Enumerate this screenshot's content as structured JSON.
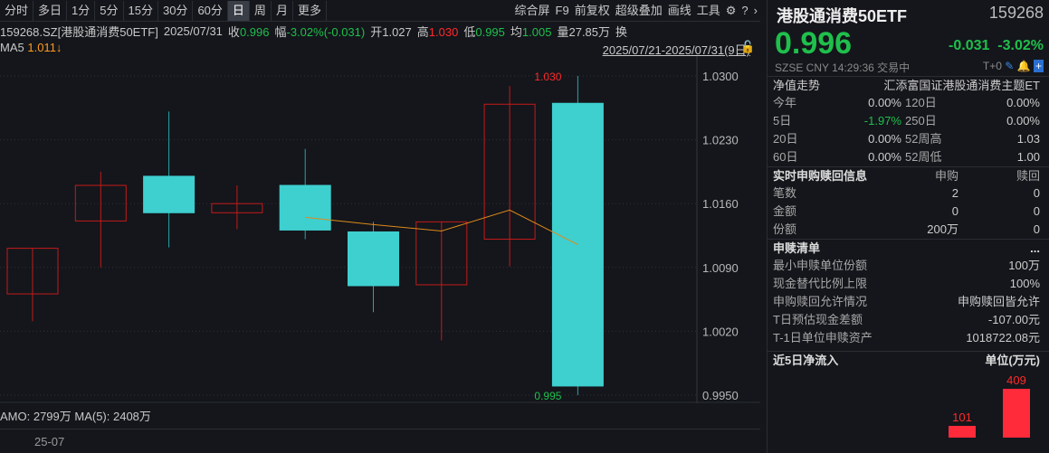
{
  "toolbar": {
    "periods": [
      "分时",
      "多日",
      "1分",
      "5分",
      "15分",
      "30分",
      "60分",
      "日",
      "周",
      "月",
      "更多"
    ],
    "active": "日",
    "right": [
      "综合屏",
      "F9",
      "前复权",
      "超级叠加",
      "画线",
      "工具"
    ]
  },
  "info": {
    "code": "159268.SZ[港股通消费50ETF]",
    "date": "2025/07/31",
    "close_label": "收",
    "close": "0.996",
    "chg_label": "幅",
    "chg": "-3.02%(-0.031)",
    "open_label": "开",
    "open": "1.027",
    "high_label": "高",
    "high": "1.030",
    "low_label": "低",
    "low": "0.995",
    "avg_label": "均",
    "avg": "1.005",
    "vol_label": "量",
    "vol": "27.85万",
    "turn_label": "换"
  },
  "ma": {
    "label": "MA5",
    "value": "1.011↓"
  },
  "range": "2025/07/21-2025/07/31(9日)",
  "chart_data": {
    "type": "candlestick",
    "ylim": [
      0.995,
      1.03
    ],
    "yticks": [
      "1.0300",
      "1.0230",
      "1.0160",
      "1.0090",
      "1.0020",
      "0.9950"
    ],
    "candles": [
      {
        "o": 1.0061,
        "h": 1.0111,
        "l": 1.0031,
        "c": 1.0111
      },
      {
        "o": 1.0141,
        "h": 1.0195,
        "l": 1.009,
        "c": 1.018
      },
      {
        "o": 1.019,
        "h": 1.0261,
        "l": 1.0112,
        "c": 1.015
      },
      {
        "o": 1.015,
        "h": 1.018,
        "l": 1.0132,
        "c": 1.016
      },
      {
        "o": 1.018,
        "h": 1.022,
        "l": 1.0121,
        "c": 1.0131
      },
      {
        "o": 1.0129,
        "h": 1.014,
        "l": 1.0041,
        "c": 1.007
      },
      {
        "o": 1.0071,
        "h": 1.014,
        "l": 1.001,
        "c": 1.014
      },
      {
        "o": 1.0121,
        "h": 1.0289,
        "l": 1.0091,
        "c": 1.0269
      },
      {
        "o": 1.027,
        "h": 1.03,
        "l": 0.995,
        "c": 0.996
      }
    ],
    "ma5": [
      null,
      null,
      null,
      null,
      1.0145,
      1.0137,
      1.013,
      1.0153,
      1.0115
    ],
    "high_mark": "1.030",
    "low_mark": "0.995",
    "xlabel": "25-07"
  },
  "amo": "AMO: 2799万 MA(5): 2408万",
  "side": {
    "name": "港股通消费50ETF",
    "code": "159268",
    "price": "0.996",
    "chg": "-0.031",
    "pct": "-3.02%",
    "meta": "SZSE  CNY  14:29:36  交易中",
    "t0": "T+0",
    "nav_title": "净值走势",
    "fund": "汇添富国证港股通消费主题ET",
    "perf": [
      [
        "今年",
        "0.00%",
        "120日",
        "0.00%"
      ],
      [
        "5日",
        "-1.97%",
        "250日",
        "0.00%"
      ],
      [
        "20日",
        "0.00%",
        "52周高",
        "1.03"
      ],
      [
        "60日",
        "0.00%",
        "52周低",
        "1.00"
      ]
    ],
    "sub_title": "实时申购赎回信息",
    "sub_h1": "申购",
    "sub_h2": "赎回",
    "sub": [
      [
        "笔数",
        "2",
        "0"
      ],
      [
        "金额",
        "0",
        "0"
      ],
      [
        "份额",
        "200万",
        "0"
      ]
    ],
    "list_title": "申赎清单",
    "more": "...",
    "list": [
      [
        "最小申赎单位份额",
        "100万"
      ],
      [
        "现金替代比例上限",
        "100%"
      ],
      [
        "申购赎回允许情况",
        "申购赎回皆允许"
      ],
      [
        "T日预估现金差额",
        "-107.00元"
      ],
      [
        "T-1日单位申赎资产",
        "1018722.08元"
      ]
    ],
    "flow_title": "近5日净流入",
    "flow_unit": "单位(万元)",
    "flow": [
      {
        "v": 101,
        "label": "101"
      },
      {
        "v": 409,
        "label": "409"
      }
    ]
  }
}
